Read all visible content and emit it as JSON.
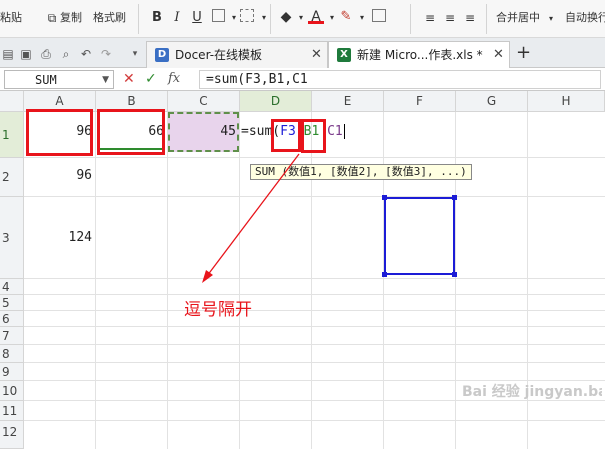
{
  "ribbon": {
    "paste_label": "粘贴",
    "copy_label": "复制",
    "format_painter_label": "格式刷",
    "bold_label": "B",
    "italic_label": "I",
    "underline_label": "U",
    "font_color_glyph": "A",
    "merge_center_label": "合并居中",
    "auto_wrap_label": "自动换行"
  },
  "tabs": [
    {
      "label": "Docer-在线模板",
      "icon": "D"
    },
    {
      "label": "新建 Micro...作表.xls *",
      "icon": "X"
    }
  ],
  "add_tab_label": "+",
  "formula_bar": {
    "name_box": "SUM",
    "fx_label": "fx",
    "formula": "=sum(F3,B1,C1"
  },
  "columns": [
    "A",
    "B",
    "C",
    "D",
    "E",
    "F",
    "G",
    "H"
  ],
  "rows": [
    "1",
    "2",
    "3",
    "4",
    "5",
    "6",
    "7",
    "8",
    "9",
    "10",
    "11",
    "12"
  ],
  "cells": {
    "A1": "96",
    "B1": "66",
    "C1": "45",
    "A2": "96",
    "A3": "124"
  },
  "editing": {
    "prefix": "=sum(",
    "arg1": "F3",
    "arg2": "B1",
    "arg3": "C1"
  },
  "tooltip": "SUM (数值1, [数值2], [数值3], ...)",
  "annotation": "逗号隔开",
  "watermark": "Bai 经验 jingyan.baidu.com",
  "colors": {
    "annotation_red": "#e8141b",
    "blue_ref": "#1c1cd6",
    "green_ref": "#2e8b2e",
    "purple_fill": "#e8d4ec",
    "selected_header": "#e3edd8"
  }
}
